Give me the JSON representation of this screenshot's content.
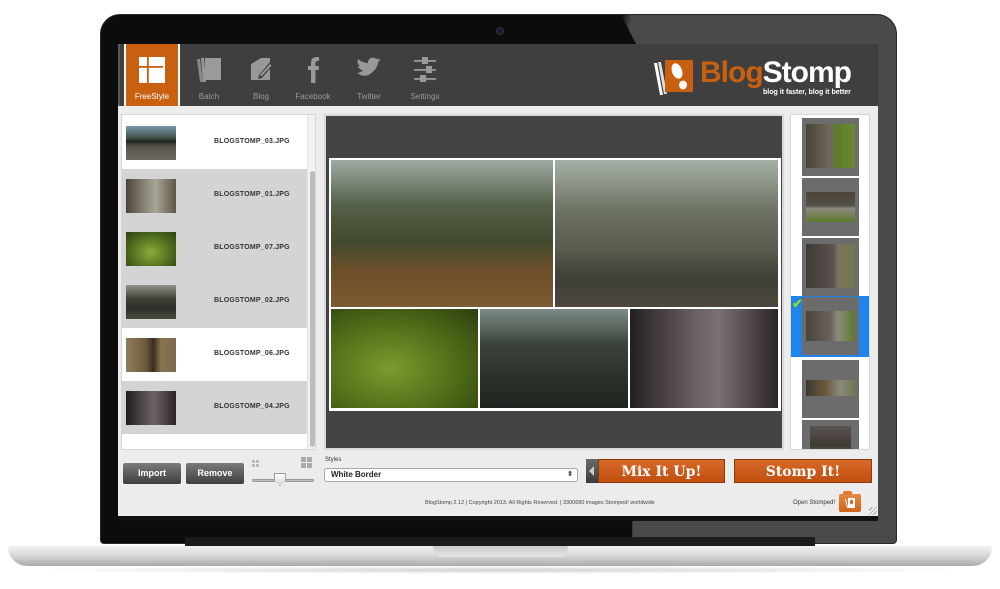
{
  "app": {
    "name": "BlogStomp",
    "logo_text_orange": "Blog",
    "logo_text_white": "Stomp",
    "tagline": "blog it faster, blog it better",
    "accent_color": "#c9600f"
  },
  "toolbar": {
    "items": [
      {
        "label": "FreeStyle",
        "icon": "freestyle-layout-icon",
        "active": true
      },
      {
        "label": "Batch",
        "icon": "batch-stack-icon",
        "active": false
      },
      {
        "label": "Blog",
        "icon": "blog-pencil-icon",
        "active": false
      },
      {
        "label": "Facebook",
        "icon": "facebook-icon",
        "active": false
      },
      {
        "label": "Twitter",
        "icon": "twitter-bird-icon",
        "active": false
      },
      {
        "label": "Settings",
        "icon": "settings-sliders-icon",
        "active": false
      }
    ]
  },
  "files": [
    {
      "name": "BLOGSTOMP_03.JPG",
      "highlight": false
    },
    {
      "name": "BLOGSTOMP_01.JPG",
      "highlight": true
    },
    {
      "name": "BLOGSTOMP_07.JPG",
      "highlight": true
    },
    {
      "name": "BLOGSTOMP_02.JPG",
      "highlight": true
    },
    {
      "name": "BLOGSTOMP_06.JPG",
      "highlight": false
    },
    {
      "name": "BLOGSTOMP_04.JPG",
      "highlight": true
    }
  ],
  "controls": {
    "import_label": "Import",
    "remove_label": "Remove",
    "thumb_size_fraction": 0.45,
    "styles_label": "Styles",
    "styles_value": "White Border",
    "mix_label": "Mix It Up!",
    "stomp_label": "Stomp It!"
  },
  "layouts": {
    "count_visible": 6,
    "selected_index": 3
  },
  "footer": {
    "text": "BlogStomp 2.12 | Copyright 2013, All Rights Reserved. | 3300680 images Stomped! worldwide",
    "open_label": "Open Stomped!"
  }
}
